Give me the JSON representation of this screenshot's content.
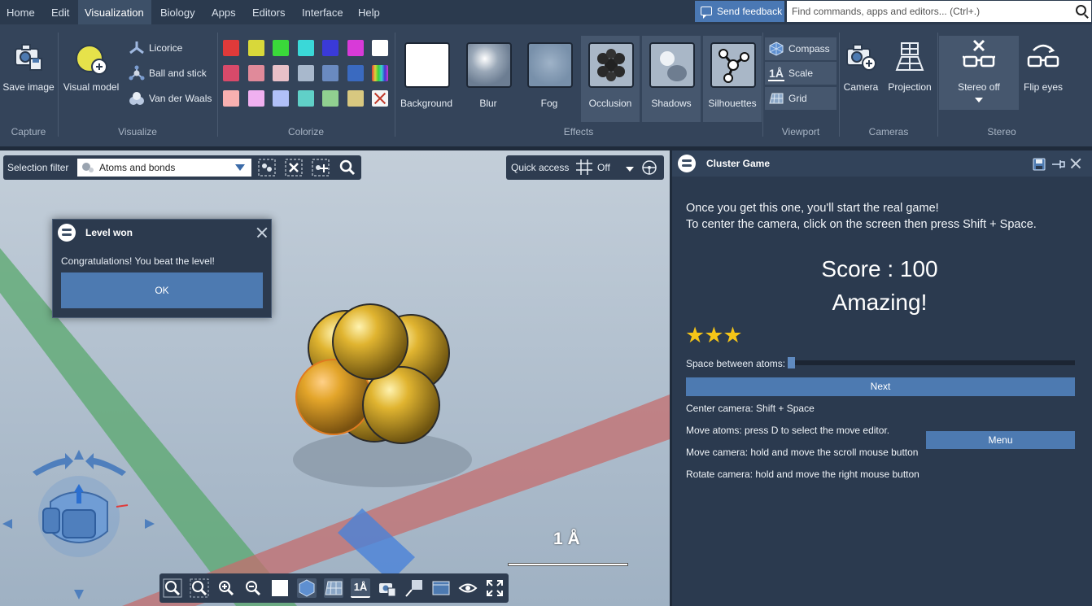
{
  "menu": {
    "items": [
      "Home",
      "Edit",
      "Visualization",
      "Biology",
      "Apps",
      "Editors",
      "Interface",
      "Help"
    ],
    "active": "Visualization",
    "feedback_label": "Send feedback",
    "search_placeholder": "Find commands, apps and editors... (Ctrl+.)"
  },
  "ribbon": {
    "capture": {
      "group": "Capture",
      "save_image": "Save image"
    },
    "visualize": {
      "group": "Visualize",
      "visual_model": "Visual model",
      "licorice": "Licorice",
      "ball_and_stick": "Ball and stick",
      "van_der_waals": "Van der Waals"
    },
    "colorize": {
      "group": "Colorize",
      "row1": [
        "#e03a3a",
        "#d8d83a",
        "#3ad83a",
        "#3ad8d8",
        "#3a3ad8",
        "#d83ad8",
        "#ffffff"
      ],
      "row2": [
        "#d84a6a",
        "#e08a9a",
        "#e8c0c8",
        "#a8b8cc",
        "#6a8ac0",
        "#3a6ac0",
        "rainbow"
      ],
      "row3": [
        "#f8b0b0",
        "#f0b0f0",
        "#b0c0f8",
        "#60d0c8",
        "#90d090",
        "#d8c880",
        "none"
      ]
    },
    "effects": {
      "group": "Effects",
      "items": [
        "Background",
        "Blur",
        "Fog",
        "Occlusion",
        "Shadows",
        "Silhouettes"
      ]
    },
    "viewport": {
      "group": "Viewport",
      "compass": "Compass",
      "scale": "Scale",
      "grid": "Grid"
    },
    "cameras": {
      "group": "Cameras",
      "camera": "Camera",
      "projection": "Projection"
    },
    "stereo": {
      "group": "Stereo",
      "stereo_off": "Stereo off",
      "flip_eyes": "Flip eyes"
    }
  },
  "viewport": {
    "selection_filter_label": "Selection filter",
    "selection_filter_value": "Atoms and bonds",
    "quick_access_label": "Quick access",
    "quick_access_value": "Off",
    "scale_label": "1 Å",
    "dialog": {
      "title": "Level won",
      "message": "Congratulations! You beat the level!",
      "ok": "OK"
    }
  },
  "panel": {
    "title": "Cluster Game",
    "intro1": "Once you get this one, you'll start the real game!",
    "intro2": "To center the camera, click on the screen then press Shift + Space.",
    "score": "Score : 100",
    "rating": "Amazing!",
    "stars_earned": 3,
    "stars_text": "★★★",
    "space_label": "Space between atoms:",
    "space_value": 0,
    "next": "Next",
    "menu": "Menu",
    "help": [
      "Center camera: Shift + Space",
      "Move atoms: press D to select the move editor.",
      "Move camera: hold and move the scroll mouse button",
      "Rotate camera: hold and move the right mouse button"
    ]
  },
  "colors": {
    "accent": "#4d7ab1",
    "panel": "#2b3a4f",
    "star": "#f5c518",
    "atom": "#d4a820"
  }
}
